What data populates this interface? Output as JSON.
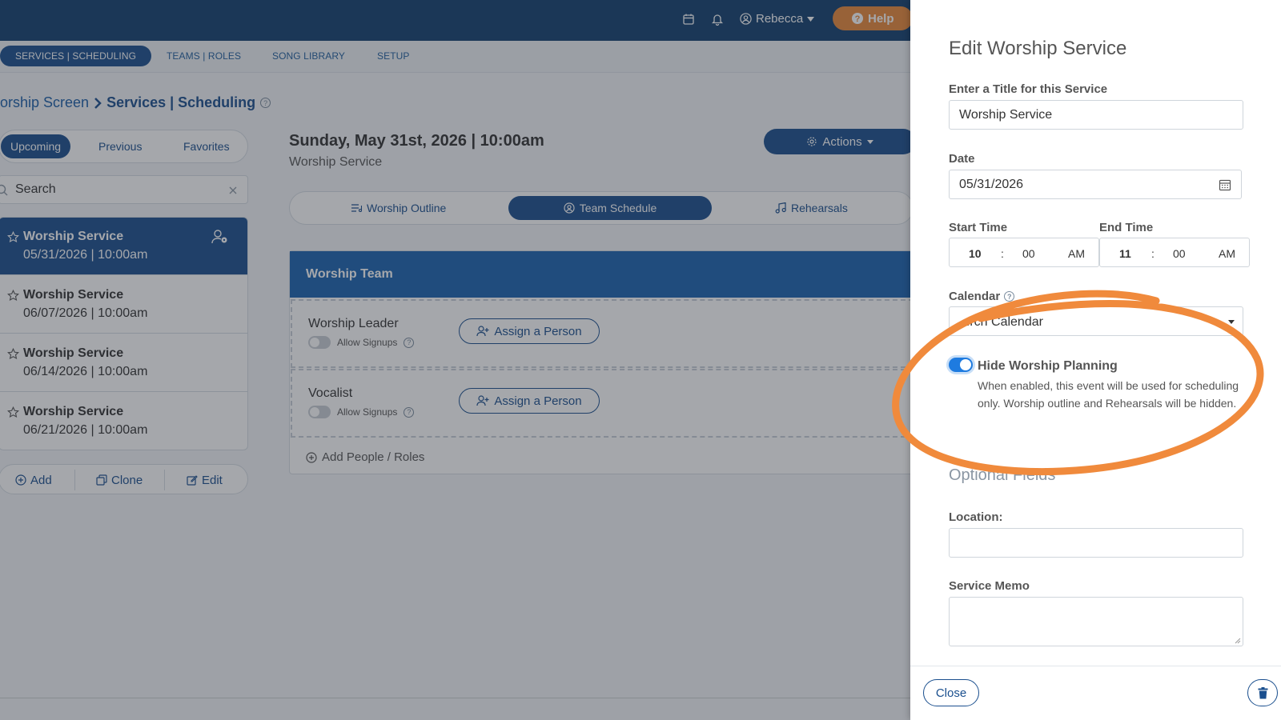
{
  "topbar": {
    "user_name": "Rebecca",
    "help_label": "Help"
  },
  "nav": {
    "tabs": [
      "SERVICES | SCHEDULING",
      "TEAMS | ROLES",
      "SONG LIBRARY",
      "SETUP"
    ]
  },
  "breadcrumb": {
    "parent": "orship Screen",
    "current": "Services | Scheduling"
  },
  "filters": [
    "Upcoming",
    "Previous",
    "Favorites"
  ],
  "search": {
    "placeholder": "Search"
  },
  "services": [
    {
      "title": "Worship Service",
      "date": "05/31/2026 | 10:00am"
    },
    {
      "title": "Worship Service",
      "date": "06/07/2026 | 10:00am"
    },
    {
      "title": "Worship Service",
      "date": "06/14/2026 | 10:00am"
    },
    {
      "title": "Worship Service",
      "date": "06/21/2026 | 10:00am"
    }
  ],
  "list_actions": {
    "add": "Add",
    "clone": "Clone",
    "edit": "Edit"
  },
  "main": {
    "heading": "Sunday, May 31st, 2026 | 10:00am",
    "subheading": "Worship Service",
    "actions_label": "Actions",
    "view_tabs": [
      "Worship Outline",
      "Team Schedule",
      "Rehearsals"
    ],
    "team_title": "Worship Team",
    "roles": [
      {
        "name": "Worship Leader",
        "signups": "Allow Signups",
        "assign": "Assign a Person"
      },
      {
        "name": "Vocalist",
        "signups": "Allow Signups",
        "assign": "Assign a Person"
      }
    ],
    "add_people": "Add People / Roles"
  },
  "drawer": {
    "title": "Edit Worship Service",
    "title_label": "Enter a Title for this Service",
    "title_value": "Worship Service",
    "date_label": "Date",
    "date_value": "05/31/2026",
    "start_label": "Start Time",
    "start": {
      "hour": "10",
      "min": "00",
      "ampm": "AM"
    },
    "end_label": "End Time",
    "end": {
      "hour": "11",
      "min": "00",
      "ampm": "AM"
    },
    "calendar_label": "Calendar",
    "calendar_value": "...rch Calendar",
    "hide_title": "Hide Worship Planning",
    "hide_desc": "When enabled, this event will be used for scheduling only. Worship outline and Rehearsals will be hidden.",
    "hide_enabled": true,
    "optional_title": "Optional Fields",
    "location_label": "Location:",
    "location_value": "",
    "memo_label": "Service Memo",
    "memo_value": "",
    "close_label": "Close"
  },
  "colors": {
    "primary": "#1a4f8e",
    "topbar": "#123f6f",
    "help": "#e8893a",
    "annotation": "#f08a3c",
    "toggle_on": "#1e7be0"
  }
}
